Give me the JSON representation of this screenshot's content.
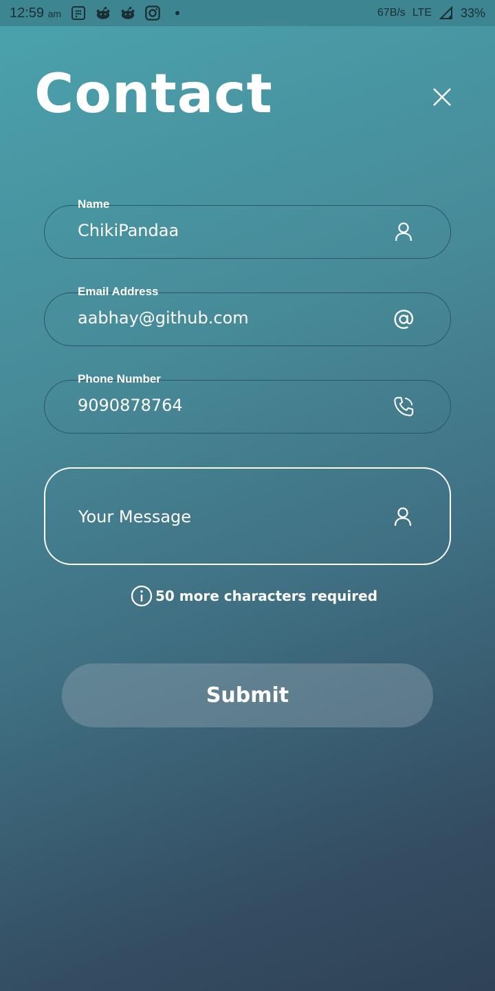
{
  "status_bar": {
    "time": "12:59",
    "ampm": "am",
    "network_speed": "67B/s",
    "network_type": "LTE",
    "battery": "33%",
    "notification_icons": [
      "calendar-grid-icon",
      "reddit-icon",
      "reddit-icon",
      "instagram-icon",
      "dot-icon"
    ]
  },
  "header": {
    "title": "Contact",
    "close_icon": "close-icon"
  },
  "form": {
    "name": {
      "label": "Name",
      "value": "ChikiPandaa",
      "icon": "person-icon"
    },
    "email": {
      "label": "Email Address",
      "value": "aabhay@github.com",
      "icon": "at-icon"
    },
    "phone": {
      "label": "Phone Number",
      "value": "9090878764",
      "icon": "phone-icon"
    },
    "message": {
      "placeholder": "Your Message",
      "value": "",
      "icon": "person-icon"
    },
    "hint": "50 more characters required",
    "submit_label": "Submit"
  },
  "colors": {
    "gradient_top": "#4aa3ae",
    "gradient_bottom": "#2f4256",
    "field_border": "#2a5562",
    "text": "#ffffff"
  }
}
